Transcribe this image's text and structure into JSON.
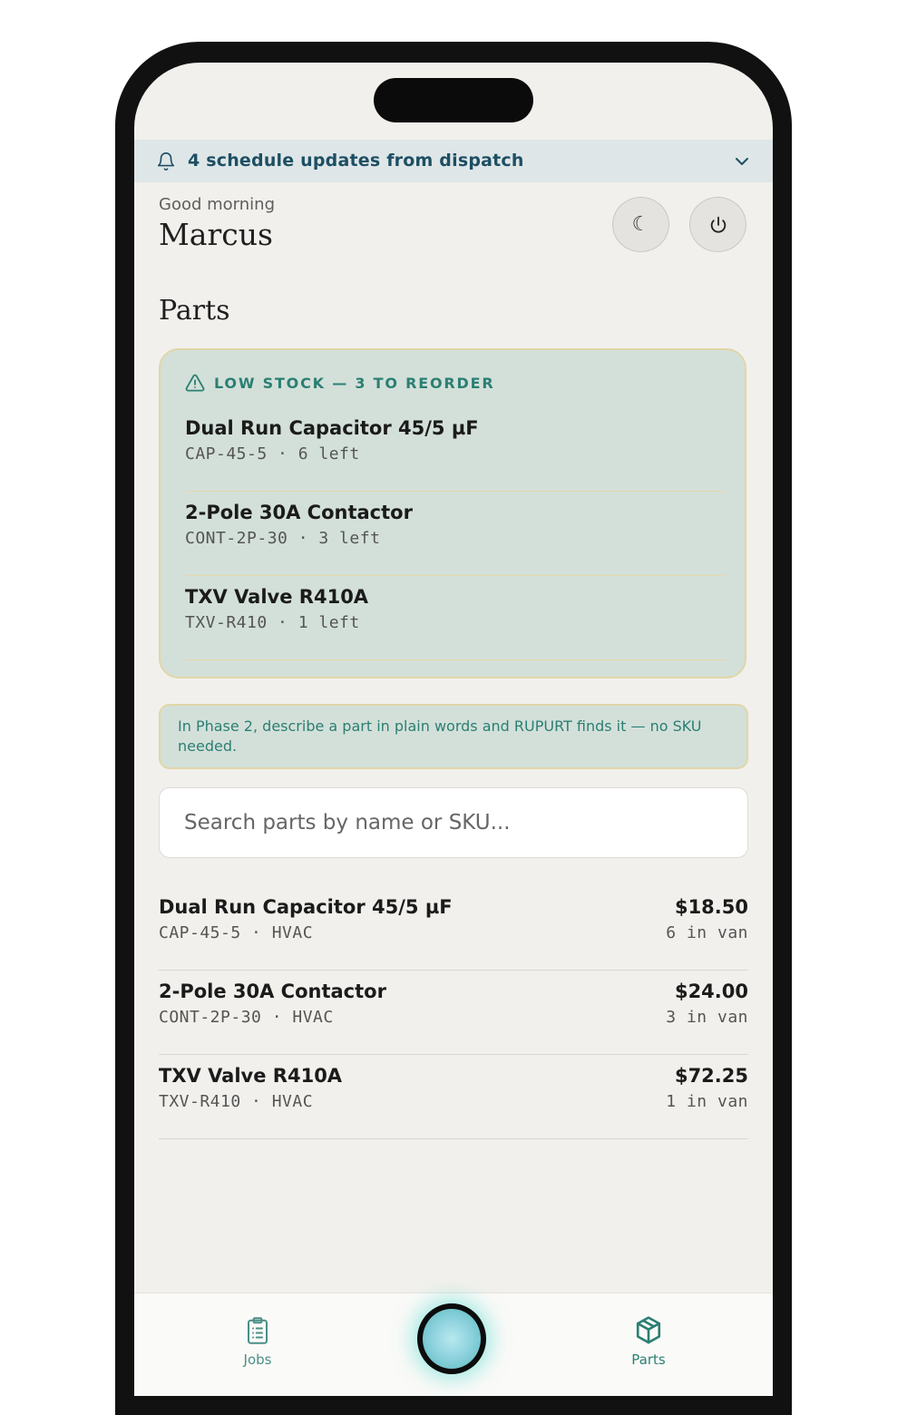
{
  "banner": {
    "text": "4 schedule updates from dispatch"
  },
  "header": {
    "greeting": "Good morning",
    "name": "Marcus",
    "theme_icon": "☾",
    "power_icon": "⏻"
  },
  "section_title": "Parts",
  "low_stock": {
    "title": "LOW STOCK — 3 TO REORDER",
    "items": [
      {
        "name": "Dual Run Capacitor 45/5 µF",
        "meta": "CAP-45-5 · 6 left"
      },
      {
        "name": "2-Pole 30A Contactor",
        "meta": "CONT-2P-30 · 3 left"
      },
      {
        "name": "TXV Valve R410A",
        "meta": "TXV-R410 · 1 left"
      }
    ]
  },
  "tip": "In Phase 2, describe a part in plain words and RUPURT finds it — no SKU needed.",
  "search": {
    "placeholder": "Search parts by name or SKU...",
    "value": ""
  },
  "parts": [
    {
      "name": "Dual Run Capacitor 45/5 µF",
      "meta": "CAP-45-5 · HVAC",
      "price": "$18.50",
      "stock": "6 in van"
    },
    {
      "name": "2-Pole 30A Contactor",
      "meta": "CONT-2P-30 · HVAC",
      "price": "$24.00",
      "stock": "3 in van"
    },
    {
      "name": "TXV Valve R410A",
      "meta": "TXV-R410 · HVAC",
      "price": "$72.25",
      "stock": "1 in van"
    }
  ],
  "tabbar": {
    "jobs_label": "Jobs",
    "parts_label": "Parts"
  },
  "colors": {
    "accent": "#2b7f73",
    "banner_text": "#1d4f63",
    "card_bg": "#d3e0d9",
    "card_border": "#e1d6a8"
  }
}
